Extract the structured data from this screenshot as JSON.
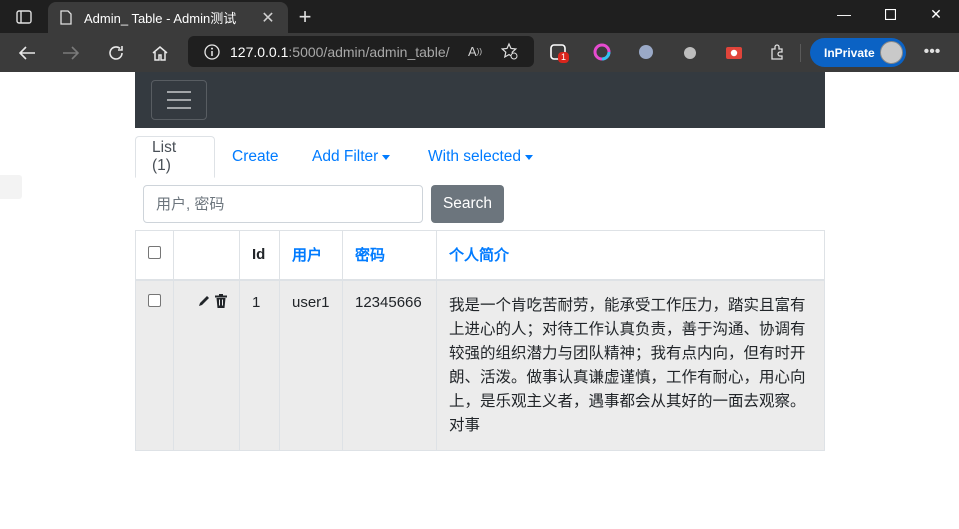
{
  "browser": {
    "tab_title": "Admin_ Table - Admin测试",
    "url_host": "127.0.0.1",
    "url_rest": ":5000/admin/admin_table/",
    "ext_badge": "1",
    "inprivate_label": "InPrivate"
  },
  "tabs": {
    "list": "List (1)",
    "create": "Create",
    "add_filter": "Add Filter",
    "with_selected": "With selected"
  },
  "search": {
    "placeholder": "用户, 密码",
    "button": "Search"
  },
  "table": {
    "headers": [
      "Id",
      "用户",
      "密码",
      "个人简介"
    ],
    "rows": [
      {
        "id": "1",
        "user": "user1",
        "password": "12345666",
        "bio": "我是一个肯吃苦耐劳，能承受工作压力，踏实且富有上进心的人；对待工作认真负责，善于沟通、协调有较强的组织潜力与团队精神；我有点内向，但有时开朗、活泼。做事认真谦虚谨慎，工作有耐心，用心向上，是乐观主义者，遇事都会从其好的一面去观察。对事"
      }
    ]
  }
}
